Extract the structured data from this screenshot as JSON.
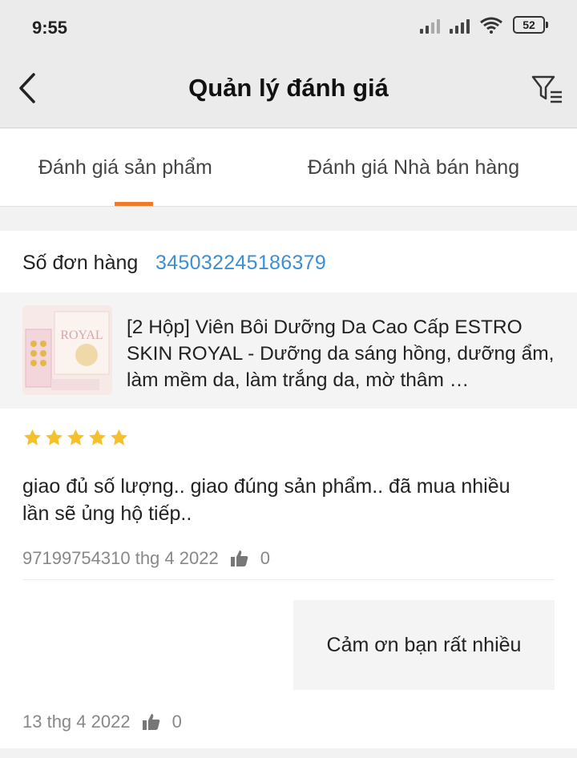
{
  "status_bar": {
    "time": "9:55",
    "battery": "52"
  },
  "header": {
    "title": "Quản lý đánh giá"
  },
  "tabs": [
    {
      "label": "Đánh giá sản phẩm",
      "active": true
    },
    {
      "label": "Đánh giá Nhà bán hàng",
      "active": false
    }
  ],
  "order": {
    "label": "Số đơn hàng",
    "number": "345032245186379"
  },
  "product": {
    "name": "[2 Hộp] Viên Bôi Dưỡng Da Cao Cấp ESTRO SKIN ROYAL - Dưỡng da sáng hồng, dưỡng ẩm, làm mềm da, làm trắng da, mờ thâm …",
    "thumb_text": "ROYAL"
  },
  "review": {
    "rating": 5,
    "rating_max": 5,
    "text": "giao đủ số lượng.. giao đúng sản phẩm.. đã mua nhiều lần sẽ ủng hộ tiếp..",
    "meta": "97199754310 thg 4 2022",
    "likes": "0",
    "reply": "Cảm ơn bạn rất nhiều",
    "reply_meta": "13 thg 4 2022",
    "reply_likes": "0"
  },
  "colors": {
    "accent": "#ee7a2a",
    "link": "#3d8fd1",
    "star": "#f5c02a"
  }
}
